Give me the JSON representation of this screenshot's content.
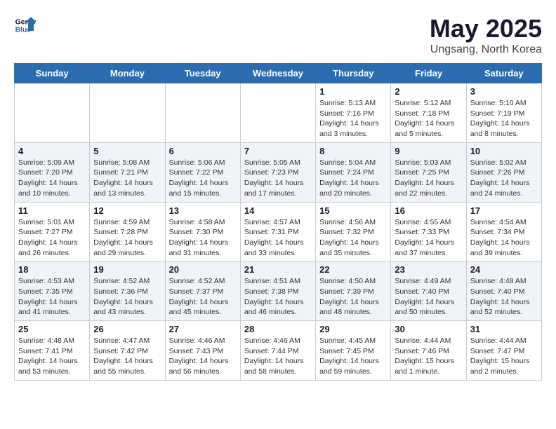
{
  "header": {
    "logo_line1": "General",
    "logo_line2": "Blue",
    "month_title": "May 2025",
    "location": "Ungsang, North Korea"
  },
  "days_of_week": [
    "Sunday",
    "Monday",
    "Tuesday",
    "Wednesday",
    "Thursday",
    "Friday",
    "Saturday"
  ],
  "weeks": [
    [
      {
        "day": "",
        "info": ""
      },
      {
        "day": "",
        "info": ""
      },
      {
        "day": "",
        "info": ""
      },
      {
        "day": "",
        "info": ""
      },
      {
        "day": "1",
        "info": "Sunrise: 5:13 AM\nSunset: 7:16 PM\nDaylight: 14 hours\nand 3 minutes."
      },
      {
        "day": "2",
        "info": "Sunrise: 5:12 AM\nSunset: 7:18 PM\nDaylight: 14 hours\nand 5 minutes."
      },
      {
        "day": "3",
        "info": "Sunrise: 5:10 AM\nSunset: 7:19 PM\nDaylight: 14 hours\nand 8 minutes."
      }
    ],
    [
      {
        "day": "4",
        "info": "Sunrise: 5:09 AM\nSunset: 7:20 PM\nDaylight: 14 hours\nand 10 minutes."
      },
      {
        "day": "5",
        "info": "Sunrise: 5:08 AM\nSunset: 7:21 PM\nDaylight: 14 hours\nand 13 minutes."
      },
      {
        "day": "6",
        "info": "Sunrise: 5:06 AM\nSunset: 7:22 PM\nDaylight: 14 hours\nand 15 minutes."
      },
      {
        "day": "7",
        "info": "Sunrise: 5:05 AM\nSunset: 7:23 PM\nDaylight: 14 hours\nand 17 minutes."
      },
      {
        "day": "8",
        "info": "Sunrise: 5:04 AM\nSunset: 7:24 PM\nDaylight: 14 hours\nand 20 minutes."
      },
      {
        "day": "9",
        "info": "Sunrise: 5:03 AM\nSunset: 7:25 PM\nDaylight: 14 hours\nand 22 minutes."
      },
      {
        "day": "10",
        "info": "Sunrise: 5:02 AM\nSunset: 7:26 PM\nDaylight: 14 hours\nand 24 minutes."
      }
    ],
    [
      {
        "day": "11",
        "info": "Sunrise: 5:01 AM\nSunset: 7:27 PM\nDaylight: 14 hours\nand 26 minutes."
      },
      {
        "day": "12",
        "info": "Sunrise: 4:59 AM\nSunset: 7:28 PM\nDaylight: 14 hours\nand 29 minutes."
      },
      {
        "day": "13",
        "info": "Sunrise: 4:58 AM\nSunset: 7:30 PM\nDaylight: 14 hours\nand 31 minutes."
      },
      {
        "day": "14",
        "info": "Sunrise: 4:57 AM\nSunset: 7:31 PM\nDaylight: 14 hours\nand 33 minutes."
      },
      {
        "day": "15",
        "info": "Sunrise: 4:56 AM\nSunset: 7:32 PM\nDaylight: 14 hours\nand 35 minutes."
      },
      {
        "day": "16",
        "info": "Sunrise: 4:55 AM\nSunset: 7:33 PM\nDaylight: 14 hours\nand 37 minutes."
      },
      {
        "day": "17",
        "info": "Sunrise: 4:54 AM\nSunset: 7:34 PM\nDaylight: 14 hours\nand 39 minutes."
      }
    ],
    [
      {
        "day": "18",
        "info": "Sunrise: 4:53 AM\nSunset: 7:35 PM\nDaylight: 14 hours\nand 41 minutes."
      },
      {
        "day": "19",
        "info": "Sunrise: 4:52 AM\nSunset: 7:36 PM\nDaylight: 14 hours\nand 43 minutes."
      },
      {
        "day": "20",
        "info": "Sunrise: 4:52 AM\nSunset: 7:37 PM\nDaylight: 14 hours\nand 45 minutes."
      },
      {
        "day": "21",
        "info": "Sunrise: 4:51 AM\nSunset: 7:38 PM\nDaylight: 14 hours\nand 46 minutes."
      },
      {
        "day": "22",
        "info": "Sunrise: 4:50 AM\nSunset: 7:39 PM\nDaylight: 14 hours\nand 48 minutes."
      },
      {
        "day": "23",
        "info": "Sunrise: 4:49 AM\nSunset: 7:40 PM\nDaylight: 14 hours\nand 50 minutes."
      },
      {
        "day": "24",
        "info": "Sunrise: 4:48 AM\nSunset: 7:40 PM\nDaylight: 14 hours\nand 52 minutes."
      }
    ],
    [
      {
        "day": "25",
        "info": "Sunrise: 4:48 AM\nSunset: 7:41 PM\nDaylight: 14 hours\nand 53 minutes."
      },
      {
        "day": "26",
        "info": "Sunrise: 4:47 AM\nSunset: 7:42 PM\nDaylight: 14 hours\nand 55 minutes."
      },
      {
        "day": "27",
        "info": "Sunrise: 4:46 AM\nSunset: 7:43 PM\nDaylight: 14 hours\nand 56 minutes."
      },
      {
        "day": "28",
        "info": "Sunrise: 4:46 AM\nSunset: 7:44 PM\nDaylight: 14 hours\nand 58 minutes."
      },
      {
        "day": "29",
        "info": "Sunrise: 4:45 AM\nSunset: 7:45 PM\nDaylight: 14 hours\nand 59 minutes."
      },
      {
        "day": "30",
        "info": "Sunrise: 4:44 AM\nSunset: 7:46 PM\nDaylight: 15 hours\nand 1 minute."
      },
      {
        "day": "31",
        "info": "Sunrise: 4:44 AM\nSunset: 7:47 PM\nDaylight: 15 hours\nand 2 minutes."
      }
    ]
  ]
}
